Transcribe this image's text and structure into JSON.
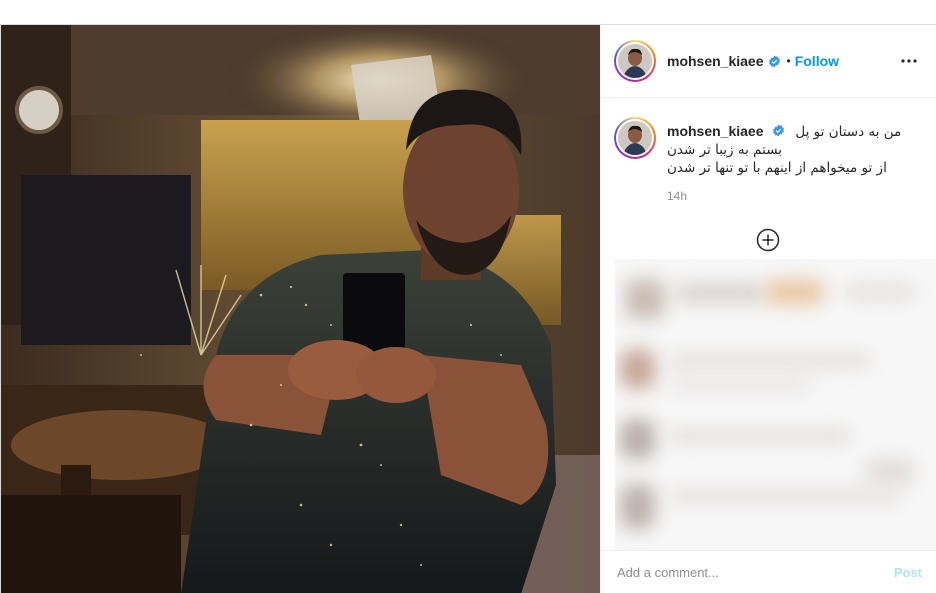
{
  "post": {
    "username": "mohsen_kiaee",
    "separator": "•",
    "follow_label": "Follow",
    "more_icon": "more-horizontal-icon",
    "verified_icon": "verified-badge-icon",
    "colors": {
      "accent": "#0095f6",
      "post_disabled": "#b2dffc",
      "muted": "#8e8e8e"
    }
  },
  "caption": {
    "username": "mohsen_kiaee",
    "lines": [
      "من به دستان تو پل",
      "بستم به زیبا تر شدن",
      "از تو میخواهم از اینهم با تو تنها تر شدن"
    ],
    "time": "14h"
  },
  "comments": {
    "load_more_icon": "add-circle-icon"
  },
  "comment_bar": {
    "placeholder": "Add a comment...",
    "post_label": "Post"
  }
}
